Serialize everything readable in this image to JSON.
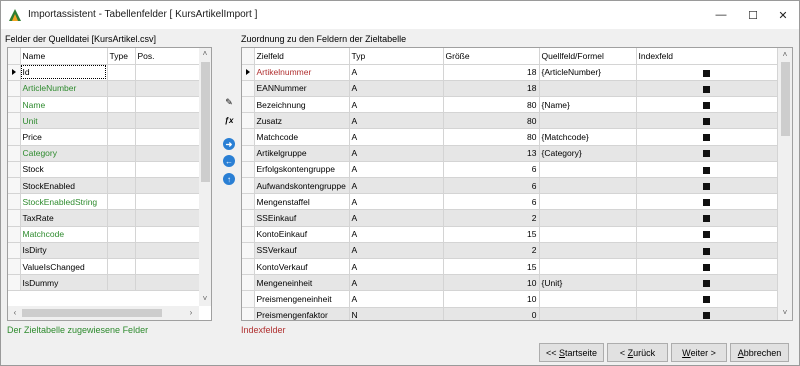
{
  "window": {
    "title": "Importassistent - Tabellenfelder [ KursArtikelImport ]",
    "controls": {
      "minimize": "—",
      "maximize": "☐",
      "close": "✕"
    }
  },
  "left": {
    "label": "Felder der Quelldatei [KursArtikel.csv]",
    "columns": [
      "Name",
      "Type",
      "Pos."
    ],
    "rows": [
      {
        "name": "Id",
        "color": "black",
        "selected": true
      },
      {
        "name": "ArticleNumber",
        "color": "green"
      },
      {
        "name": "Name",
        "color": "green"
      },
      {
        "name": "Unit",
        "color": "green"
      },
      {
        "name": "Price",
        "color": "black"
      },
      {
        "name": "Category",
        "color": "green"
      },
      {
        "name": "Stock",
        "color": "black"
      },
      {
        "name": "StockEnabled",
        "color": "black"
      },
      {
        "name": "StockEnabledString",
        "color": "green"
      },
      {
        "name": "TaxRate",
        "color": "black"
      },
      {
        "name": "Matchcode",
        "color": "green"
      },
      {
        "name": "IsDirty",
        "color": "black"
      },
      {
        "name": "ValueIsChanged",
        "color": "black"
      },
      {
        "name": "IsDummy",
        "color": "black"
      }
    ],
    "footnote": "Der Zieltabelle zugewiesene Felder"
  },
  "tools": [
    "wand-icon",
    "formula-icon",
    "arrow-right-icon",
    "arrow-left-icon",
    "arrow-up-icon"
  ],
  "tool_glyphs": [
    "✎",
    "ƒx",
    "➜",
    "←",
    "↑"
  ],
  "right": {
    "label": "Zuordnung zu den Feldern der Zieltabelle",
    "columns": [
      "Zielfeld",
      "Typ",
      "Größe",
      "Quellfeld/Formel",
      "Indexfeld"
    ],
    "rows": [
      {
        "field": "Artikelnummer",
        "typ": "A",
        "size": "18",
        "source": "{ArticleNumber}",
        "index": true,
        "red": true
      },
      {
        "field": "EANNummer",
        "typ": "A",
        "size": "18",
        "source": "",
        "index": true
      },
      {
        "field": "Bezeichnung",
        "typ": "A",
        "size": "80",
        "source": "{Name}",
        "index": true
      },
      {
        "field": "Zusatz",
        "typ": "A",
        "size": "80",
        "source": "",
        "index": true
      },
      {
        "field": "Matchcode",
        "typ": "A",
        "size": "80",
        "source": "{Matchcode}",
        "index": true
      },
      {
        "field": "Artikelgruppe",
        "typ": "A",
        "size": "13",
        "source": "{Category}",
        "index": true
      },
      {
        "field": "Erfolgskontengruppe",
        "typ": "A",
        "size": "6",
        "source": "",
        "index": true
      },
      {
        "field": "Aufwandskontengruppe",
        "typ": "A",
        "size": "6",
        "source": "",
        "index": true
      },
      {
        "field": "Mengenstaffel",
        "typ": "A",
        "size": "6",
        "source": "",
        "index": true
      },
      {
        "field": "SSEinkauf",
        "typ": "A",
        "size": "2",
        "source": "",
        "index": true
      },
      {
        "field": "KontoEinkauf",
        "typ": "A",
        "size": "15",
        "source": "",
        "index": true
      },
      {
        "field": "SSVerkauf",
        "typ": "A",
        "size": "2",
        "source": "",
        "index": true
      },
      {
        "field": "KontoVerkauf",
        "typ": "A",
        "size": "15",
        "source": "",
        "index": true
      },
      {
        "field": "Mengeneinheit",
        "typ": "A",
        "size": "10",
        "source": "{Unit}",
        "index": true
      },
      {
        "field": "Preismengeneinheit",
        "typ": "A",
        "size": "10",
        "source": "",
        "index": true
      },
      {
        "field": "Preismengenfaktor",
        "typ": "N",
        "size": "0",
        "source": "",
        "index": true
      }
    ],
    "footnote": "Indexfelder"
  },
  "buttons": {
    "start": {
      "prefix": "<< ",
      "mnemonic": "S",
      "rest": "tartseite"
    },
    "back": {
      "prefix": "< ",
      "mnemonic": "Z",
      "rest": "urück"
    },
    "next": {
      "prefix": "",
      "mnemonic": "W",
      "rest": "eiter >"
    },
    "cancel": {
      "prefix": "",
      "mnemonic": "A",
      "rest": "bbrechen"
    }
  },
  "colors": {
    "green": "#2e8b2e",
    "red": "#b03030",
    "accent": "#2a7fd4"
  }
}
